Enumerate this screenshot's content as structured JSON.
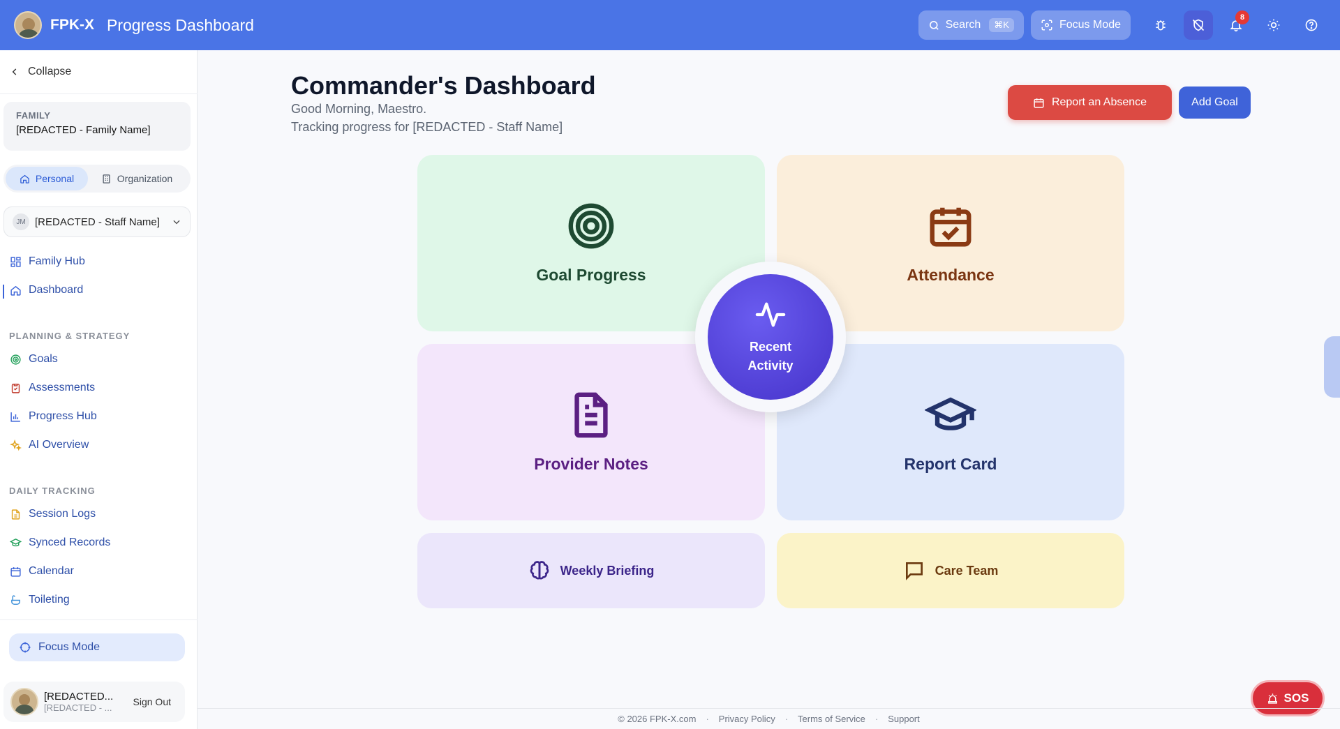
{
  "header": {
    "brand": "FPK-X",
    "title": "Progress Dashboard",
    "search_label": "Search",
    "search_shortcut": "⌘K",
    "focus_label": "Focus Mode",
    "notification_count": "8",
    "accent_color": "#4a74e6"
  },
  "sidebar": {
    "collapse_label": "Collapse",
    "family": {
      "label": "FAMILY",
      "value": "[REDACTED - Family Name]"
    },
    "scope": {
      "personal": "Personal",
      "organization": "Organization",
      "selected": "Personal"
    },
    "staff": {
      "initials": "JM",
      "name": "[REDACTED - Staff Name]"
    },
    "primary_nav": [
      {
        "label": "Family Hub",
        "icon": "grid-icon"
      },
      {
        "label": "Dashboard",
        "icon": "home-icon",
        "active": true
      }
    ],
    "sections": [
      {
        "heading": "PLANNING & STRATEGY",
        "items": [
          {
            "label": "Goals",
            "icon": "target-icon"
          },
          {
            "label": "Assessments",
            "icon": "clipboard-icon"
          },
          {
            "label": "Progress Hub",
            "icon": "bar-chart-icon"
          },
          {
            "label": "AI Overview",
            "icon": "sparkles-icon"
          }
        ]
      },
      {
        "heading": "DAILY TRACKING",
        "items": [
          {
            "label": "Session Logs",
            "icon": "file-text-icon"
          },
          {
            "label": "Synced Records",
            "icon": "graduation-cap-icon"
          },
          {
            "label": "Calendar",
            "icon": "calendar-icon"
          },
          {
            "label": "Toileting",
            "icon": "bath-icon"
          }
        ]
      }
    ],
    "focus_mode_label": "Focus Mode",
    "user": {
      "name": "[REDACTED...",
      "sub": "[REDACTED - ...",
      "sign_out": "Sign Out"
    }
  },
  "main": {
    "title": "Commander's Dashboard",
    "greeting": "Good Morning, Maestro.",
    "tracking": "Tracking progress for [REDACTED - Staff Name]",
    "report_absence_label": "Report an Absence",
    "add_goal_label": "Add Goal",
    "tiles": {
      "goal_progress": "Goal Progress",
      "attendance": "Attendance",
      "provider_notes": "Provider Notes",
      "report_card": "Report Card",
      "recent_activity": "Recent Activity",
      "weekly_briefing": "Weekly Briefing",
      "care_team": "Care Team"
    },
    "sos_label": "SOS"
  },
  "footer": {
    "copyright": "© 2026 FPK-X.com",
    "privacy": "Privacy Policy",
    "terms": "Terms of Service",
    "support": "Support"
  }
}
